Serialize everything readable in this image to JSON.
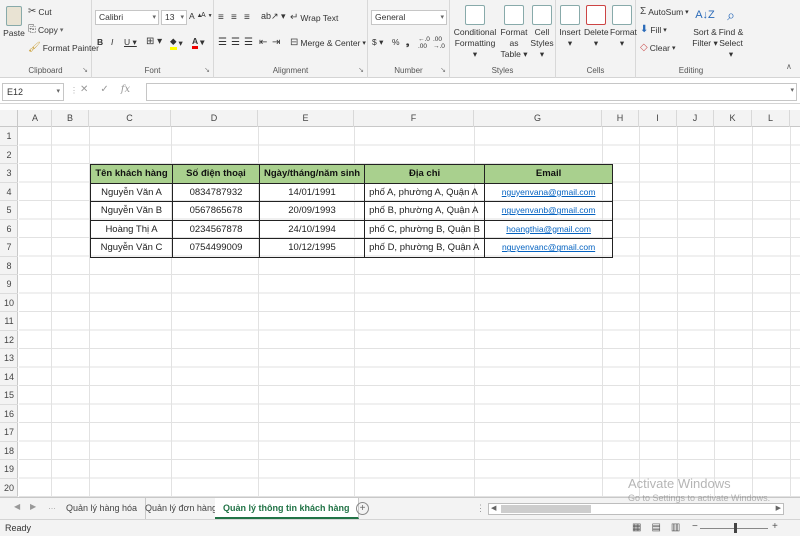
{
  "ribbon": {
    "clipboard": {
      "label": "Clipboard",
      "paste": "Paste",
      "cut": "Cut",
      "copy": "Copy",
      "format_painter": "Format Painter"
    },
    "font": {
      "label": "Font",
      "font_name": "Calibri",
      "font_size": "13"
    },
    "alignment": {
      "label": "Alignment",
      "wrap_text": "Wrap Text",
      "merge_center": "Merge & Center"
    },
    "number": {
      "label": "Number",
      "format": "General"
    },
    "styles": {
      "label": "Styles",
      "conditional": "Conditional",
      "formatting": "Formatting",
      "format_as": "Format as",
      "table": "Table",
      "cell": "Cell",
      "cell_styles": "Styles"
    },
    "cells": {
      "label": "Cells",
      "insert": "Insert",
      "delete": "Delete",
      "format": "Format"
    },
    "editing": {
      "label": "Editing",
      "autosum": "AutoSum",
      "fill": "Fill",
      "clear": "Clear",
      "sort": "Sort &",
      "filter": "Filter",
      "find": "Find &",
      "select": "Select"
    }
  },
  "formula_bar": {
    "name_box": "E12",
    "formula": ""
  },
  "columns": [
    "A",
    "B",
    "C",
    "D",
    "E",
    "F",
    "G",
    "H",
    "I",
    "J",
    "K",
    "L"
  ],
  "rows": [
    "1",
    "2",
    "3",
    "4",
    "5",
    "6",
    "7",
    "8",
    "9",
    "10",
    "11",
    "12",
    "13",
    "14",
    "15",
    "16",
    "17",
    "18",
    "19",
    "20"
  ],
  "table": {
    "headers": [
      "Tên khách hàng",
      "Số điện thoại",
      "Ngày/tháng/năm sinh",
      "Địa chỉ",
      "Email"
    ],
    "rows": [
      [
        "Nguyễn Văn A",
        "0834787932",
        "14/01/1991",
        "phố A, phường A, Quận A",
        "nguyenvana@gmail.com"
      ],
      [
        "Nguyễn Văn B",
        "0567865678",
        "20/09/1993",
        "phố B, phường A, Quận A",
        "nguyenvanb@gmail.com"
      ],
      [
        "Hoàng Thị A",
        "0234567878",
        "24/10/1994",
        "phố C, phường B, Quận B",
        "hoangthia@gmail.com"
      ],
      [
        "Nguyễn Văn C",
        "0754499009",
        "10/12/1995",
        "phố D, phường B, Quận A",
        "nguyenvanc@gmail.com"
      ]
    ],
    "header_color": "#a9d08e"
  },
  "sheet_tabs": [
    "Quản lý hàng hóa",
    "Quản lý đơn hàng",
    "Quản lý thông tin khách hàng"
  ],
  "active_tab": "Quản lý thông tin khách hàng",
  "status": {
    "ready": "Ready"
  },
  "watermark": {
    "line1": "Activate Windows",
    "line2": "Go to Settings to activate Windows."
  },
  "colors": {
    "accent": "#217346",
    "link": "#0563c1"
  }
}
